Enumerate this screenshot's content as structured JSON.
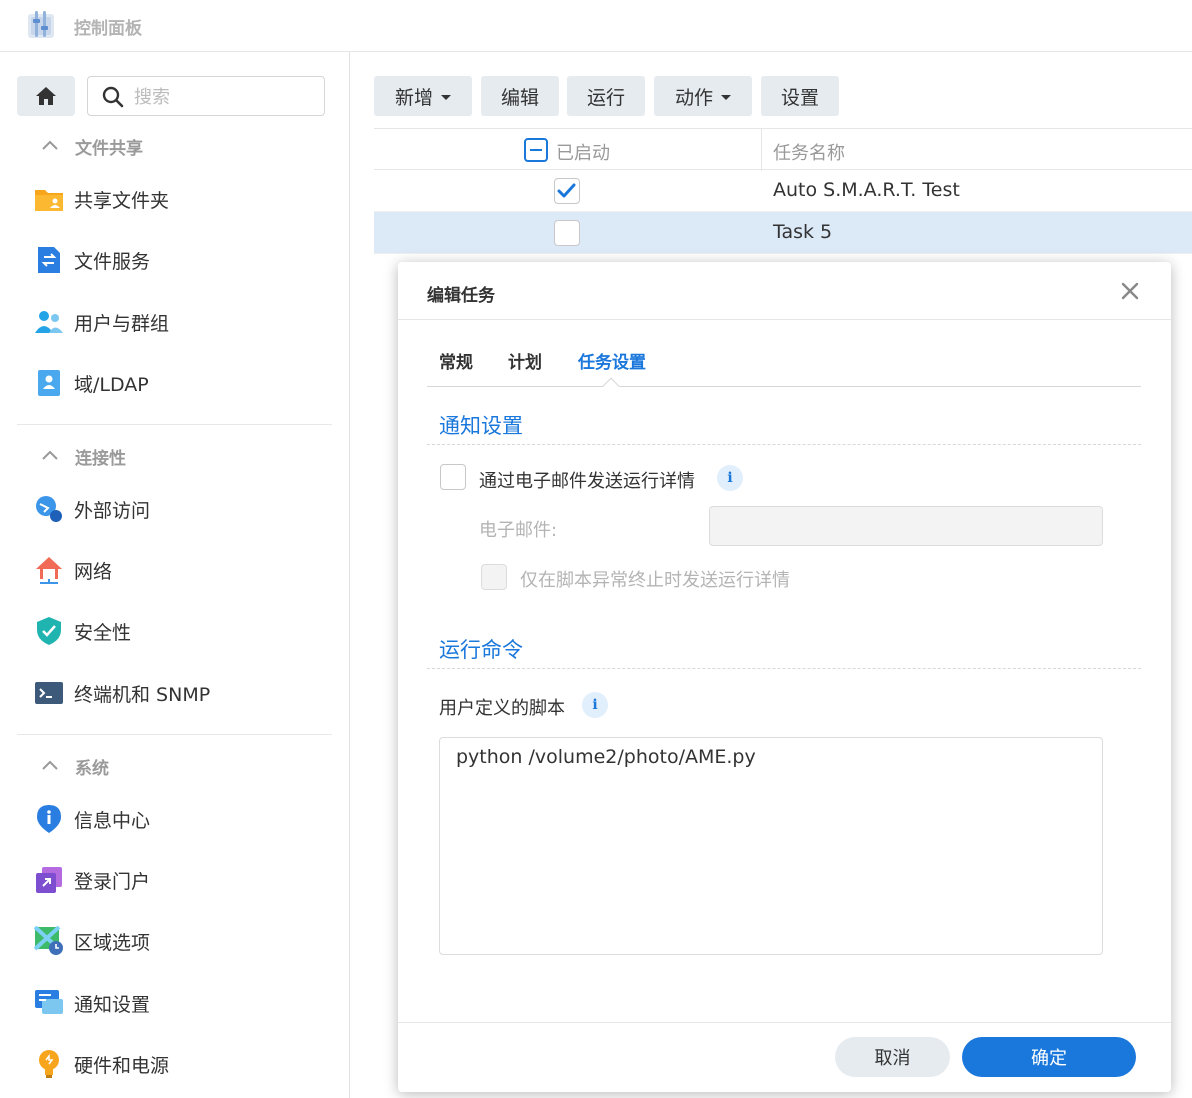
{
  "app": {
    "title": "控制面板"
  },
  "search": {
    "placeholder": "搜索"
  },
  "sidebar": {
    "sections": [
      {
        "title": "文件共享",
        "items": [
          {
            "label": "共享文件夹",
            "icon": "folder-share-icon"
          },
          {
            "label": "文件服务",
            "icon": "file-services-icon"
          },
          {
            "label": "用户与群组",
            "icon": "users-groups-icon"
          },
          {
            "label": "域/LDAP",
            "icon": "domain-ldap-icon"
          }
        ]
      },
      {
        "title": "连接性",
        "items": [
          {
            "label": "外部访问",
            "icon": "external-access-icon"
          },
          {
            "label": "网络",
            "icon": "network-icon"
          },
          {
            "label": "安全性",
            "icon": "security-shield-icon"
          },
          {
            "label": "终端机和 SNMP",
            "icon": "terminal-icon"
          }
        ]
      },
      {
        "title": "系统",
        "items": [
          {
            "label": "信息中心",
            "icon": "info-center-icon"
          },
          {
            "label": "登录门户",
            "icon": "login-portal-icon"
          },
          {
            "label": "区域选项",
            "icon": "regional-options-icon"
          },
          {
            "label": "通知设置",
            "icon": "notification-icon"
          },
          {
            "label": "硬件和电源",
            "icon": "hardware-power-icon"
          }
        ]
      }
    ]
  },
  "toolbar": {
    "create": "新增",
    "edit": "编辑",
    "run": "运行",
    "action": "动作",
    "settings": "设置"
  },
  "grid": {
    "columns": {
      "enabled": "已启动",
      "name": "任务名称"
    },
    "rows": [
      {
        "name": "Auto S.M.A.R.T. Test",
        "enabled": true,
        "selected": false
      },
      {
        "name": "Task 5",
        "enabled": false,
        "selected": true
      }
    ]
  },
  "modal": {
    "title": "编辑任务",
    "tabs": [
      {
        "label": "常规",
        "active": false
      },
      {
        "label": "计划",
        "active": false
      },
      {
        "label": "任务设置",
        "active": true
      }
    ],
    "notify": {
      "title": "通知设置",
      "send_email_label": "通过电子邮件发送运行详情",
      "send_email_checked": false,
      "email_label": "电子邮件:",
      "email_value": "",
      "abnormal_only_label": "仅在脚本异常终止时发送运行详情",
      "abnormal_only_checked": false
    },
    "command": {
      "title": "运行命令",
      "script_label": "用户定义的脚本",
      "script_value": "python /volume2/photo/AME.py"
    },
    "buttons": {
      "cancel": "取消",
      "ok": "确定"
    }
  },
  "colors": {
    "accent": "#1a77db",
    "button_bg": "#e6ebf0",
    "selected_row": "#dce9f7",
    "section_title": "#9a9a9a"
  }
}
